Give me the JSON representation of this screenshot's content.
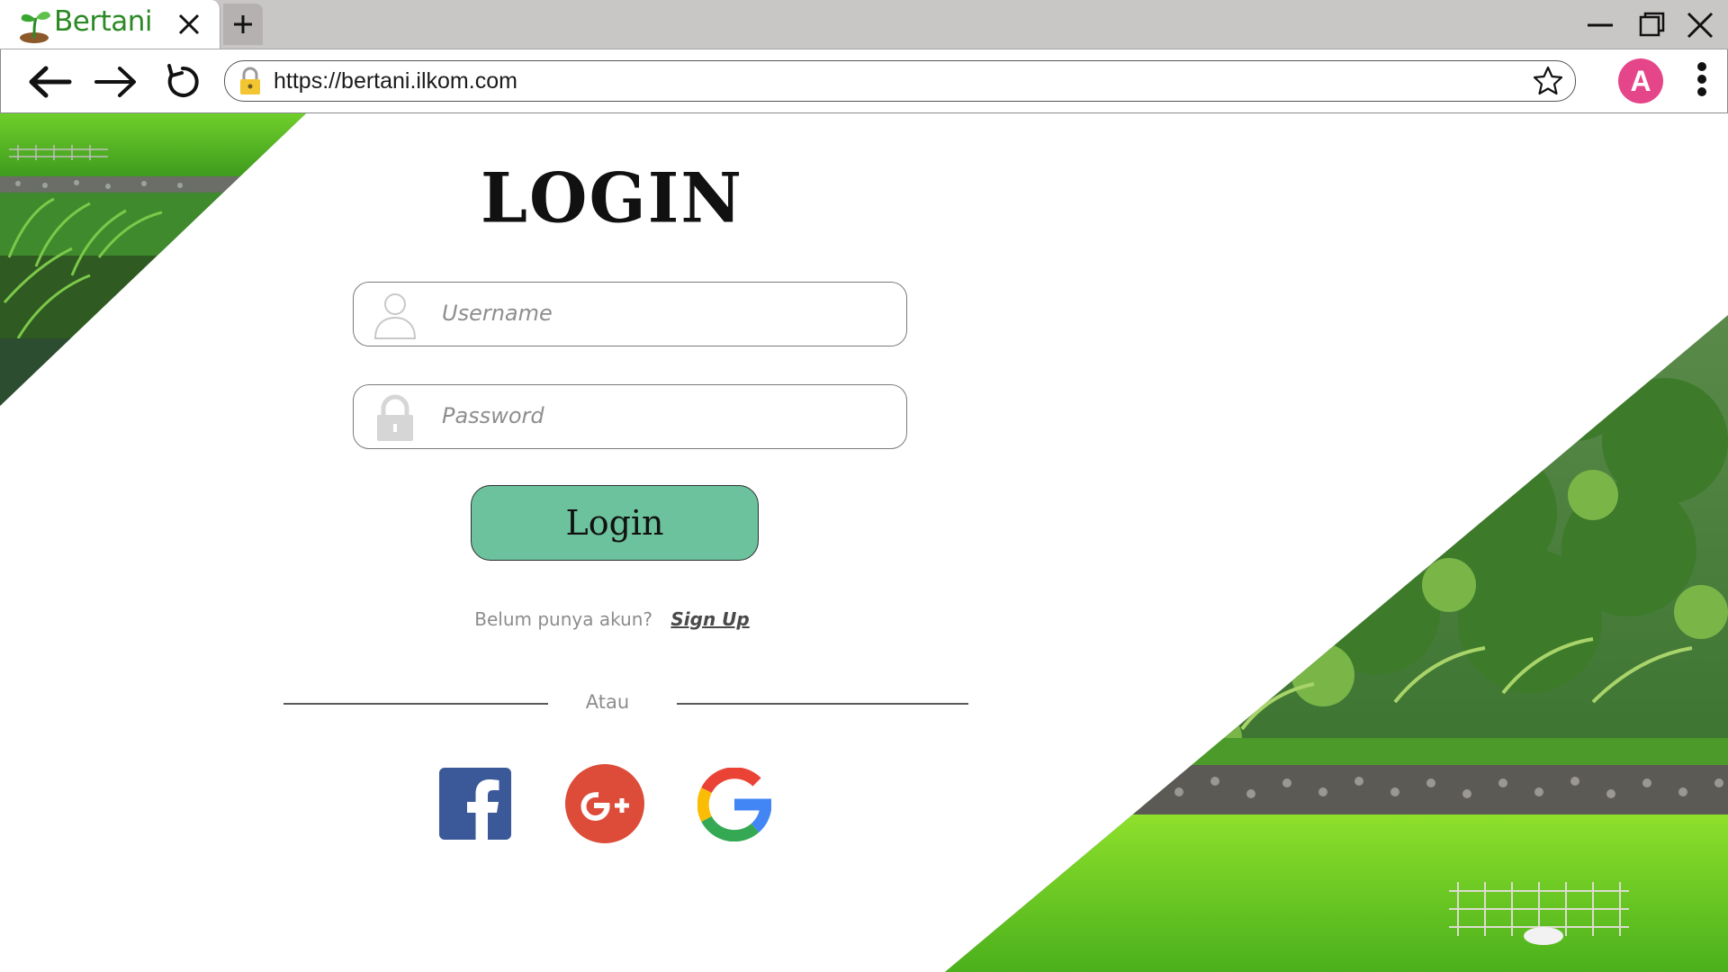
{
  "browser": {
    "tab_title": "Bertani",
    "url": "https://bertani.ilkom.com",
    "profile_initial": "A"
  },
  "login": {
    "title": "LOGIN",
    "username_placeholder": "Username",
    "password_placeholder": "Password",
    "button_label": "Login",
    "no_account_text": "Belum punya akun?",
    "signup_link": "Sign Up",
    "or_text": "Atau"
  },
  "colors": {
    "login_button": "#6cc29c",
    "facebook": "#3b5998",
    "google_plus": "#dd4b39",
    "avatar": "#e5468a"
  }
}
